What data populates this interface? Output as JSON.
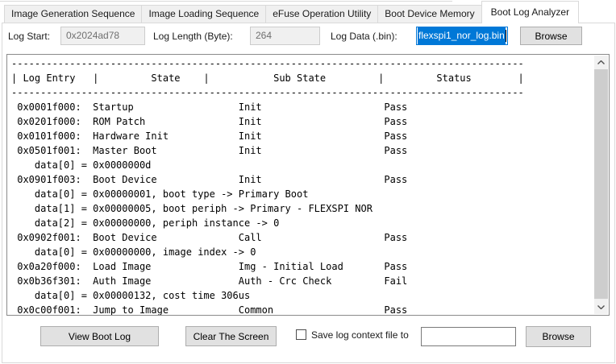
{
  "tabs": [
    {
      "label": "Image Generation Sequence",
      "active": false
    },
    {
      "label": "Image Loading Sequence",
      "active": false
    },
    {
      "label": "eFuse Operation Utility",
      "active": false
    },
    {
      "label": "Boot Device Memory",
      "active": false
    },
    {
      "label": "Boot Log Analyzer",
      "active": true
    }
  ],
  "fields": {
    "log_start": {
      "label": "Log Start:",
      "value": "0x2024ad78"
    },
    "log_length": {
      "label": "Log Length (Byte):",
      "value": "264"
    },
    "log_data": {
      "label": "Log Data (.bin):",
      "value": "flexspi1_nor_log.bin"
    },
    "browse_label": "Browse"
  },
  "log": {
    "columns": [
      "Log Entry",
      "State",
      "Sub State",
      "Status"
    ],
    "rows": [
      {
        "entry": "0x0001f000:",
        "state": "Startup",
        "sub_state": "Init",
        "status": "Pass",
        "data": []
      },
      {
        "entry": "0x0201f000:",
        "state": "ROM Patch",
        "sub_state": "Init",
        "status": "Pass",
        "data": []
      },
      {
        "entry": "0x0101f000:",
        "state": "Hardware Init",
        "sub_state": "Init",
        "status": "Pass",
        "data": []
      },
      {
        "entry": "0x0501f001:",
        "state": "Master Boot",
        "sub_state": "Init",
        "status": "Pass",
        "data": [
          "data[0] = 0x0000000d"
        ]
      },
      {
        "entry": "0x0901f003:",
        "state": "Boot Device",
        "sub_state": "Init",
        "status": "Pass",
        "data": [
          "data[0] = 0x00000001, boot type -> Primary Boot",
          "data[1] = 0x00000005, boot periph -> Primary - FLEXSPI NOR",
          "data[2] = 0x00000000, periph instance -> 0"
        ]
      },
      {
        "entry": "0x0902f001:",
        "state": "Boot Device",
        "sub_state": "Call",
        "status": "Pass",
        "data": [
          "data[0] = 0x00000000, image index -> 0"
        ]
      },
      {
        "entry": "0x0a20f000:",
        "state": "Load Image",
        "sub_state": "Img - Initial Load",
        "status": "Pass",
        "data": []
      },
      {
        "entry": "0x0b36f301:",
        "state": "Auth Image",
        "sub_state": "Auth - Crc Check",
        "status": "Fail",
        "data": [
          "data[0] = 0x00000132, cost time 306us"
        ]
      },
      {
        "entry": "0x0c00f001:",
        "state": "Jump to Image",
        "sub_state": "Common",
        "status": "Pass",
        "data": []
      }
    ]
  },
  "footer": {
    "view_boot_log_label": "View Boot Log",
    "clear_screen_label": "Clear The Screen",
    "save_checkbox_label": "Save log context file to",
    "save_path_value": "",
    "browse_label": "Browse"
  },
  "colors": {
    "accent_selection": "#0078d7",
    "tab_border": "#d9d9d9",
    "scrollbar_thumb": "#cdcdcd"
  }
}
